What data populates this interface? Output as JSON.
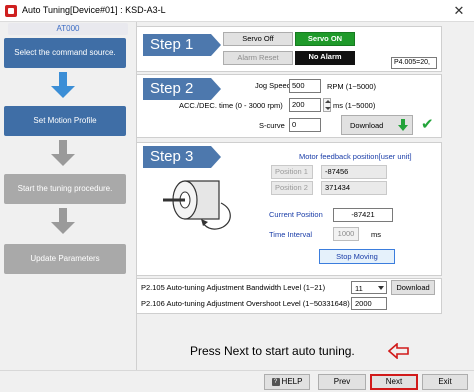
{
  "window": {
    "title": "Auto Tuning[Device#01] : KSD-A3-L",
    "close_glyph": "✕"
  },
  "sidebar": {
    "header": "AT000",
    "steps": [
      {
        "label": "Select the command source.",
        "state": "active"
      },
      {
        "label": "Set Motion Profile",
        "state": "active"
      },
      {
        "label": "Start the tuning procedure.",
        "state": "inactive"
      },
      {
        "label": "Update Parameters",
        "state": "inactive"
      }
    ]
  },
  "step1": {
    "heading": "Step 1",
    "servo_off_label": "Servo Off",
    "servo_on_label": "Servo ON",
    "alarm_reset_label": "Alarm Reset",
    "no_alarm_label": "No Alarm",
    "param_value": "P4.005=20,"
  },
  "step2": {
    "heading": "Step 2",
    "jog_speed_label": "Jog Speed",
    "jog_speed_value": "500",
    "jog_speed_unit": "RPM (1~5000)",
    "acc_label": "ACC./DEC. time (0 - 3000 rpm)",
    "acc_value": "200",
    "acc_unit": "ms (1~5000)",
    "scurve_label": "S-curve",
    "scurve_value": "0",
    "download_label": "Download"
  },
  "step3": {
    "heading": "Step 3",
    "feedback_label": "Motor feedback position[user unit]",
    "position1_label": "Position 1",
    "position1_value": "-87456",
    "position2_label": "Position 2",
    "position2_value": "371434",
    "current_position_label": "Current Position",
    "current_position_value": "-87421",
    "time_interval_label": "Time Interval",
    "time_interval_value": "1000",
    "time_interval_unit": "ms",
    "stop_moving_label": "Stop Moving"
  },
  "params": {
    "bandwidth_label": "P2.105 Auto-tuning Adjustment Bandwidth Level (1~21)",
    "bandwidth_value": "11",
    "download_label": "Download",
    "overshoot_label": "P2.106 Auto-tuning Adjustment Overshoot Level (1~50331648)",
    "overshoot_value": "2000"
  },
  "prompt": "Press Next to start auto tuning.",
  "footer": {
    "help_label": "HELP",
    "prev_label": "Prev",
    "next_label": "Next",
    "exit_label": "Exit"
  },
  "colors": {
    "accent_blue": "#3f6ea6",
    "servo_on_green": "#1f9a2a",
    "no_alarm_black": "#111111",
    "next_highlight": "#d11a1a",
    "prompt_arrow": "#d11a1a"
  }
}
